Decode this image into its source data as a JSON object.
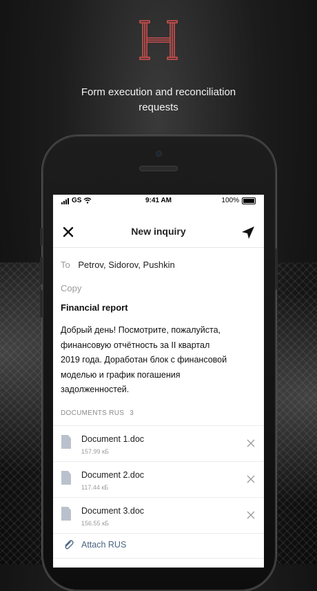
{
  "brand": {
    "logo_icon": "h-monogram-logo",
    "accent_color": "#d0504f"
  },
  "tagline": {
    "line1": "Form execution and reconciliation",
    "line2": "requests"
  },
  "status_bar": {
    "carrier": "GS",
    "time": "9:41 AM",
    "battery": "100%"
  },
  "navbar": {
    "title": "New inquiry",
    "close_icon": "close-icon",
    "send_icon": "send-icon"
  },
  "form": {
    "to_label": "To",
    "to_value": "Petrov, Sidorov, Pushkin",
    "copy_label": "Copy",
    "subject": "Financial report",
    "body_lines": [
      "Добрый день! Посмотрите, пожалуйста,",
      "финансовую отчётность за II квартал",
      "2019 года. Доработан блок с финансовой",
      "моделью и график погашения",
      "задолженностей."
    ]
  },
  "documents": {
    "header": "DOCUMENTS RUS",
    "count": "3",
    "items": [
      {
        "name": "Document 1.doc",
        "size": "157.99 кБ"
      },
      {
        "name": "Document 2.doc",
        "size": "117.44 кБ"
      },
      {
        "name": "Document 3.doc",
        "size": "156.55 кБ"
      }
    ],
    "attach_label": "Attach RUS"
  }
}
